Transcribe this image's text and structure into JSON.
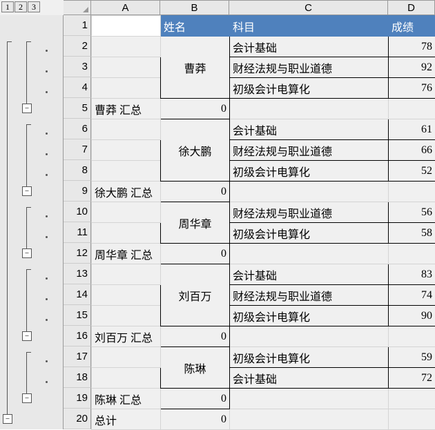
{
  "outline_levels": [
    "1",
    "2",
    "3"
  ],
  "columns": [
    "A",
    "B",
    "C",
    "D"
  ],
  "row_numbers": [
    "1",
    "2",
    "3",
    "4",
    "5",
    "6",
    "7",
    "8",
    "9",
    "10",
    "11",
    "12",
    "13",
    "14",
    "15",
    "16",
    "17",
    "18",
    "19",
    "20"
  ],
  "header": {
    "name": "姓名",
    "subject": "科目",
    "score": "成绩"
  },
  "groups": [
    {
      "name": "曹莽",
      "rows": [
        {
          "subject": "会计基础",
          "score": "78"
        },
        {
          "subject": "财经法规与职业道德",
          "score": "92"
        },
        {
          "subject": "初级会计电算化",
          "score": "76"
        }
      ],
      "subtotal_label": "曹莽 汇总",
      "subtotal": "0"
    },
    {
      "name": "徐大鹏",
      "rows": [
        {
          "subject": "会计基础",
          "score": "61"
        },
        {
          "subject": "财经法规与职业道德",
          "score": "66"
        },
        {
          "subject": "初级会计电算化",
          "score": "52"
        }
      ],
      "subtotal_label": "徐大鹏 汇总",
      "subtotal": "0"
    },
    {
      "name": "周华章",
      "rows": [
        {
          "subject": "财经法规与职业道德",
          "score": "56"
        },
        {
          "subject": "初级会计电算化",
          "score": "58"
        }
      ],
      "subtotal_label": "周华章 汇总",
      "subtotal": "0"
    },
    {
      "name": "刘百万",
      "rows": [
        {
          "subject": "会计基础",
          "score": "83"
        },
        {
          "subject": "财经法规与职业道德",
          "score": "74"
        },
        {
          "subject": "初级会计电算化",
          "score": "90"
        }
      ],
      "subtotal_label": "刘百万 汇总",
      "subtotal": "0"
    },
    {
      "name": "陈琳",
      "rows": [
        {
          "subject": "初级会计电算化",
          "score": "59"
        },
        {
          "subject": "会计基础",
          "score": "72"
        }
      ],
      "subtotal_label": "陈琳 汇总",
      "subtotal": "0"
    }
  ],
  "grand_total_label": "总计",
  "grand_total": "0",
  "collapse_glyph": "−"
}
